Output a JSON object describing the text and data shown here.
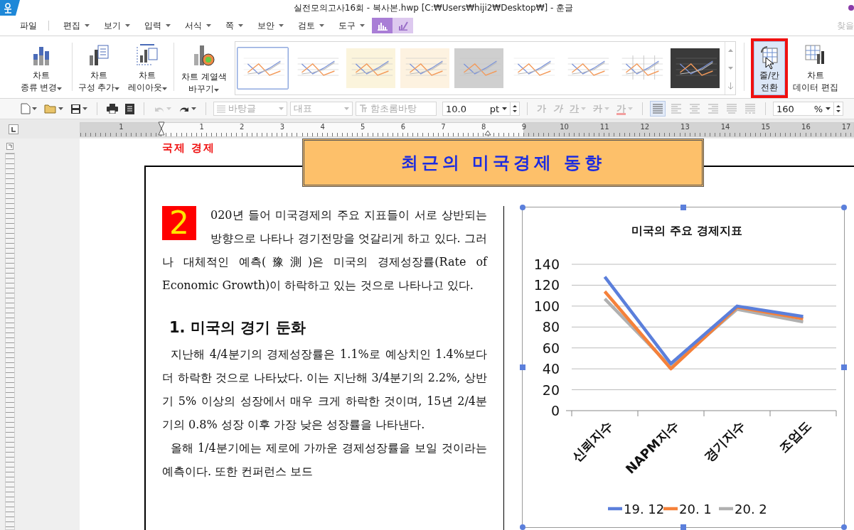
{
  "window": {
    "title": "실전모의고사16회 - 복사본.hwp [C:₩Users₩hiji2₩Desktop₩] - 훈글"
  },
  "menu": {
    "items": [
      {
        "label": "파일",
        "dropdown": false
      },
      {
        "label": "편집",
        "dropdown": true
      },
      {
        "label": "보기",
        "dropdown": true
      },
      {
        "label": "입력",
        "dropdown": true
      },
      {
        "label": "서식",
        "dropdown": true
      },
      {
        "label": "쪽",
        "dropdown": true
      },
      {
        "label": "보안",
        "dropdown": true
      },
      {
        "label": "검토",
        "dropdown": true
      },
      {
        "label": "도구",
        "dropdown": true
      }
    ],
    "context_tabs": [
      {
        "selected": true
      },
      {
        "selected": false
      }
    ],
    "find": {
      "label": "찾을",
      "disabled": true
    }
  },
  "ribbon": {
    "left_groups": [
      [
        {
          "label": "차트\n종류 변경",
          "dropdown": true,
          "pressed": false
        }
      ],
      [
        {
          "label": "차트\n구성 추가",
          "dropdown": true,
          "pressed": false
        },
        {
          "label": "차트\n레이아웃",
          "dropdown": true,
          "pressed": false
        }
      ],
      [
        {
          "label": "차트 계열색\n바꾸기",
          "dropdown": true,
          "pressed": false
        }
      ]
    ],
    "gallery": {
      "styles": [
        {
          "kind": "plain",
          "selected": true
        },
        {
          "kind": "lined",
          "selected": false
        },
        {
          "kind": "cream",
          "selected": false
        },
        {
          "kind": "warm",
          "selected": false
        },
        {
          "kind": "gray",
          "selected": false
        },
        {
          "kind": "plain",
          "selected": false
        },
        {
          "kind": "shadow",
          "selected": false
        },
        {
          "kind": "columns",
          "selected": false
        },
        {
          "kind": "dark",
          "selected": false
        }
      ]
    },
    "right_group": [
      {
        "label": "줄/칸\n전환",
        "dropdown": false,
        "pressed": true,
        "highlighted": true
      },
      {
        "label": "차트\n데이터 편집",
        "dropdown": false,
        "pressed": false,
        "highlighted": false
      }
    ]
  },
  "toolbar": {
    "undo": {
      "disabled": true
    },
    "redo": {
      "disabled": false
    },
    "style": {
      "value": "바탕글",
      "disabled": true
    },
    "outline": {
      "value": "대표",
      "disabled": true
    },
    "font": {
      "value": "함초롬바탕",
      "disabled": true
    },
    "size": {
      "value": "10.0",
      "unit": "pt"
    },
    "char_formats": [
      {
        "kind": "bold",
        "label": "가",
        "dropdown": false,
        "disabled": true
      },
      {
        "kind": "italic",
        "label": "가",
        "dropdown": false,
        "disabled": true
      },
      {
        "kind": "underline",
        "label": "가",
        "dropdown": true,
        "disabled": true
      },
      {
        "kind": "strike",
        "label": "가",
        "dropdown": true,
        "disabled": true
      },
      {
        "kind": "color",
        "label": "가",
        "dropdown": true,
        "disabled": true
      }
    ],
    "alignments": [
      {
        "kind": "justify",
        "selected": true
      },
      {
        "kind": "left",
        "selected": false
      },
      {
        "kind": "center",
        "selected": false
      },
      {
        "kind": "right",
        "selected": false
      },
      {
        "kind": "distribute",
        "selected": false
      },
      {
        "kind": "split",
        "selected": false
      }
    ],
    "zoom": {
      "value": "160",
      "unit": "%"
    }
  },
  "ruler": {
    "left_labels": [
      "1"
    ],
    "labels": [
      "1",
      "2",
      "3",
      "4",
      "5",
      "6",
      "7",
      "8",
      "9",
      "10",
      "11",
      "12",
      "13",
      "14",
      "15",
      "16",
      "17"
    ]
  },
  "document": {
    "header": "국제 경제",
    "title": "최근의 미국경제 동향",
    "drop_cap": "2",
    "paragraphs": [
      {
        "kind": "lead",
        "text": "020년 들어 미국경제의 주요 지표들이 서로 상반되는 방향으로 나타나 경기전망을 엇갈리게 하고 있다. 그러나 대체적인 예측(豫測)은 미국의 경제성장률(Rate of Economic Growth)이 하락하고 있는 것으로 나타나고 있다."
      },
      {
        "kind": "heading",
        "text": "1. 미국의 경기 둔화"
      },
      {
        "kind": "body",
        "text": "지난해 4/4분기의 경제성장률은 1.1%로 예상치인 1.4%보다 더 하락한 것으로 나타났다. 이는 지난해 3/4분기의 2.2%, 상반기 5% 이상의 성장에서 매우 크게 하락한 것이며, 15년 2/4분기의 0.8% 성장 이후 가장 낮은 성장률을 나타낸다."
      },
      {
        "kind": "body",
        "text": "올해 1/4분기에는 제로에 가까운 경제성장률을 보일 것이라는 예측이다. 또한 컨퍼런스 보드"
      }
    ],
    "chart": {
      "selected": true,
      "chart_data": {
        "type": "line",
        "title": "미국의 주요 경제지표",
        "categories": [
          "신뢰지수",
          "NAPM지수",
          "경기지수",
          "조업도"
        ],
        "series": [
          {
            "name": "19. 12",
            "color": "#5b7fdb",
            "values": [
              128,
              45,
              100,
              90
            ]
          },
          {
            "name": "20. 1",
            "color": "#f5813a",
            "values": [
              114,
              40,
              99,
              88
            ]
          },
          {
            "name": "20. 2",
            "color": "#b0b0b0",
            "values": [
              107,
              42,
              97,
              85
            ]
          }
        ],
        "ylim": [
          0,
          140
        ],
        "yticks": [
          0,
          20,
          40,
          60,
          80,
          100,
          120,
          140
        ],
        "grid": true,
        "legend": "bottom"
      }
    }
  }
}
